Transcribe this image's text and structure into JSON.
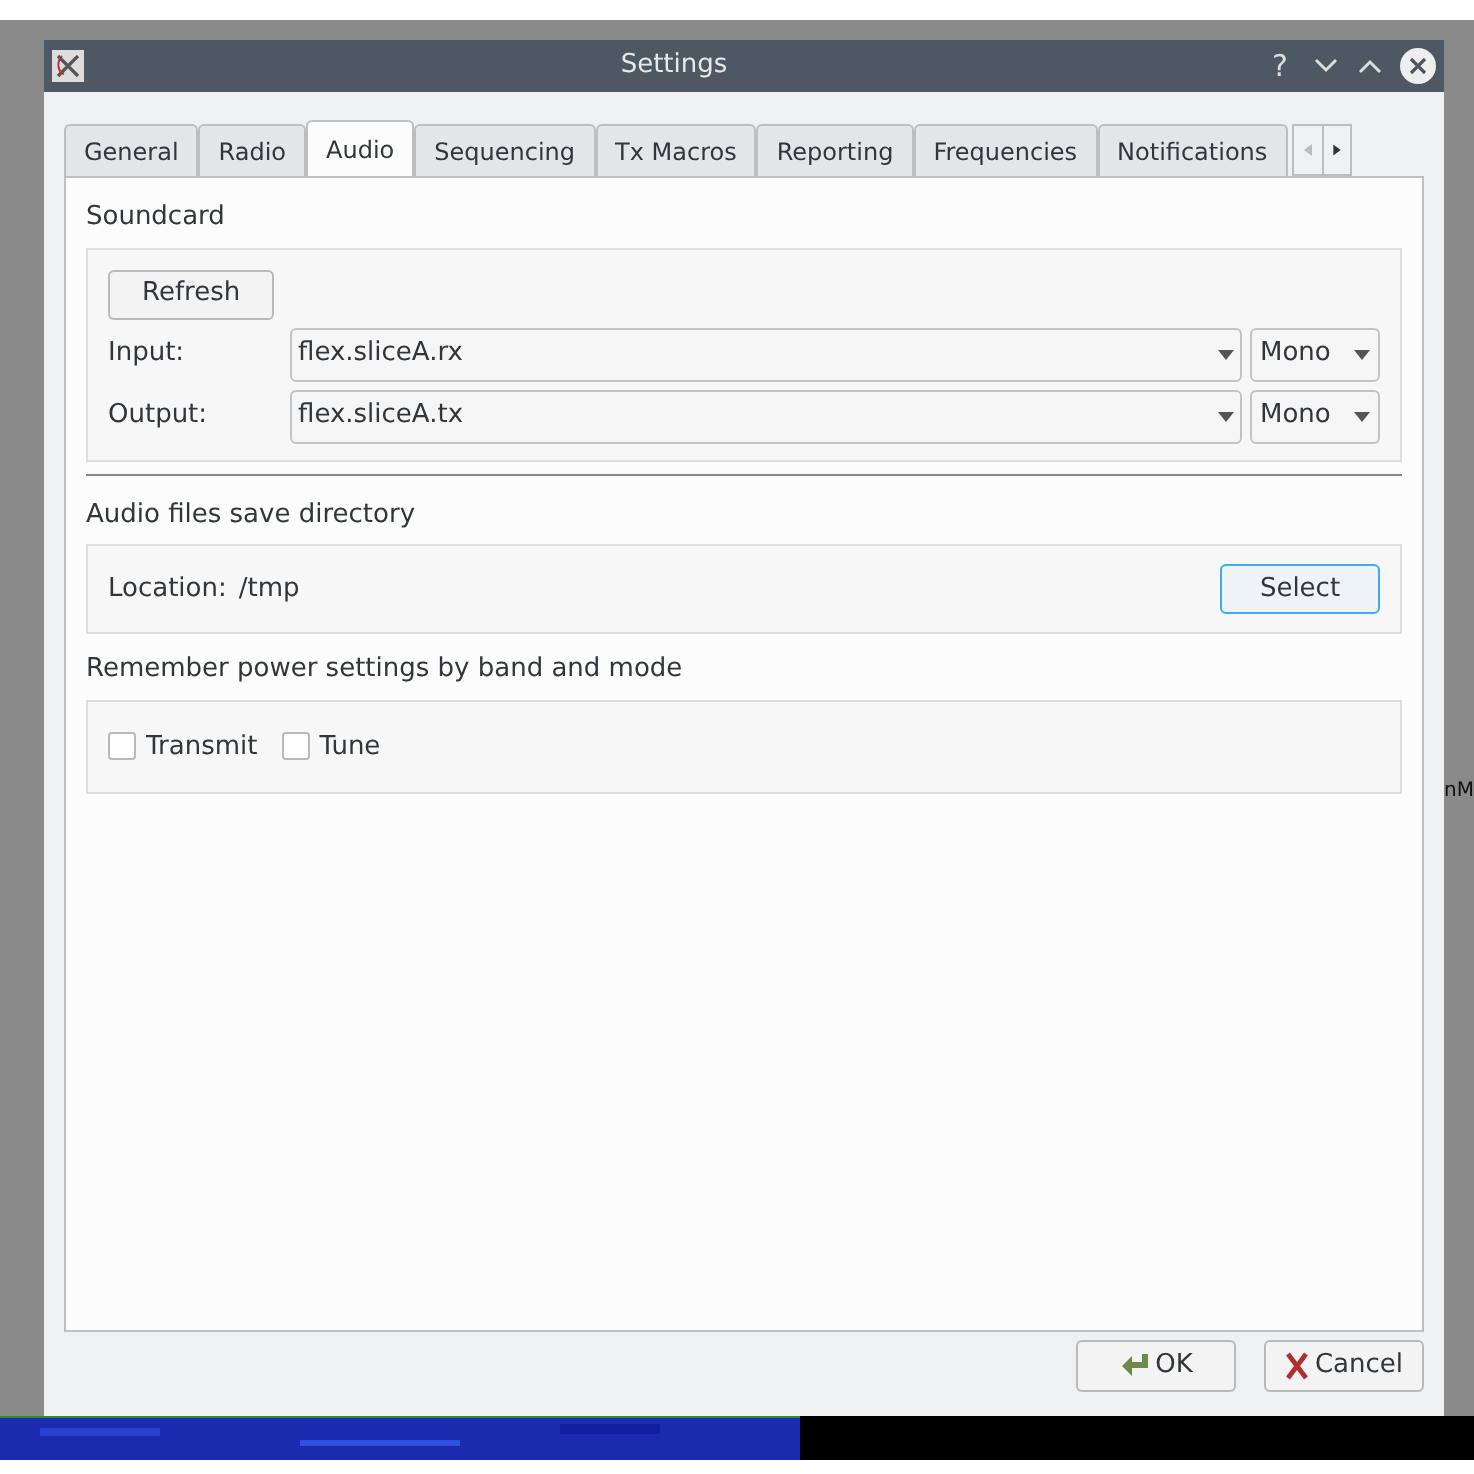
{
  "background": {
    "partial_text": "nM"
  },
  "window": {
    "title": "Settings",
    "controls": [
      "?"
    ]
  },
  "tabs": [
    {
      "label": "General",
      "selected": false
    },
    {
      "label": "Radio",
      "selected": false
    },
    {
      "label": "Audio",
      "selected": true
    },
    {
      "label": "Sequencing",
      "selected": false
    },
    {
      "label": "Tx Macros",
      "selected": false
    },
    {
      "label": "Reporting",
      "selected": false
    },
    {
      "label": "Frequencies",
      "selected": false
    },
    {
      "label": "Notifications",
      "selected": false
    }
  ],
  "soundcard": {
    "title": "Soundcard",
    "refresh": "Refresh",
    "rows": [
      {
        "label": "Input:",
        "device": "flex.sliceA.rx",
        "channel": "Mono"
      },
      {
        "label": "Output:",
        "device": "flex.sliceA.tx",
        "channel": "Mono"
      }
    ]
  },
  "save_directory": {
    "title": "Audio files save directory",
    "label": "Location:",
    "value": "/tmp",
    "button": "Select"
  },
  "power": {
    "title": "Remember power settings by band and mode",
    "checkboxes": [
      {
        "label": "Transmit",
        "checked": false
      },
      {
        "label": "Tune",
        "checked": false
      }
    ]
  },
  "buttons": [
    {
      "kind": "ok",
      "label": "OK"
    },
    {
      "kind": "cancel",
      "label": "Cancel"
    }
  ]
}
